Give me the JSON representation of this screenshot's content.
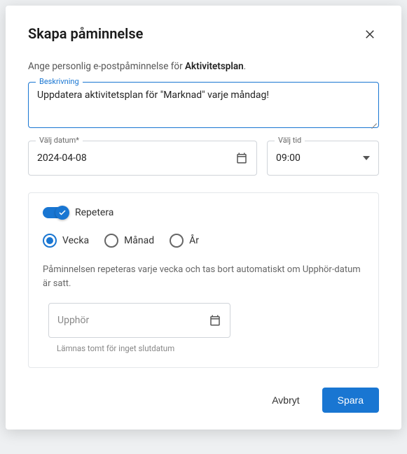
{
  "modal": {
    "title": "Skapa påminnelse",
    "intro_prefix": "Ange personlig e-postpåminnelse för ",
    "intro_bold": "Aktivitetsplan",
    "intro_suffix": "."
  },
  "description": {
    "label": "Beskrivning",
    "value": "Uppdatera aktivitetsplan för \"Marknad\" varje måndag!"
  },
  "date": {
    "label": "Välj datum*",
    "value": "2024-04-08"
  },
  "time": {
    "label": "Välj tid",
    "value": "09:00"
  },
  "repeat": {
    "toggle_label": "Repetera",
    "options": {
      "week": "Vecka",
      "month": "Månad",
      "year": "År"
    },
    "info_text": "Påminnelsen repeteras varje vecka och tas bort automatiskt om Upphör-datum är satt.",
    "end_date_placeholder": "Upphör",
    "helper_text": "Lämnas tomt för inget slutdatum"
  },
  "footer": {
    "cancel": "Avbryt",
    "save": "Spara"
  }
}
